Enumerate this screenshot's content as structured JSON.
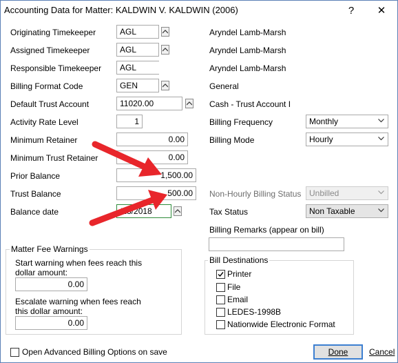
{
  "window": {
    "title": "Accounting Data for Matter: KALDWIN V. KALDWIN (2006)",
    "help_glyph": "?",
    "close_glyph": "✕"
  },
  "left_fields": {
    "originating": {
      "label": "Originating Timekeeper",
      "value": "AGL"
    },
    "assigned": {
      "label": "Assigned Timekeeper",
      "value": "AGL"
    },
    "responsible": {
      "label": "Responsible Timekeeper",
      "value": "AGL"
    },
    "billing_format": {
      "label": "Billing Format Code",
      "value": "GEN"
    },
    "trust_account": {
      "label": "Default Trust Account",
      "value": "11020.00"
    },
    "activity_rate": {
      "label": "Activity Rate Level",
      "value": "1"
    },
    "min_retainer": {
      "label": "Minimum Retainer",
      "value": "0.00"
    },
    "min_trust": {
      "label": "Minimum Trust Retainer",
      "value": "0.00"
    },
    "prior_balance": {
      "label": "Prior Balance",
      "value": "1,500.00"
    },
    "trust_balance": {
      "label": "Trust Balance",
      "value": "500.00"
    },
    "balance_date": {
      "label": "Balance date",
      "value": "/28/2018"
    }
  },
  "right_info": {
    "originating_name": "Aryndel Lamb-Marsh",
    "assigned_name": "Aryndel Lamb-Marsh",
    "responsible_name": "Aryndel Lamb-Marsh",
    "billing_format_name": "General",
    "trust_account_name": "Cash - Trust Account I"
  },
  "right_fields": {
    "billing_frequency": {
      "label": "Billing Frequency",
      "value": "Monthly"
    },
    "billing_mode": {
      "label": "Billing Mode",
      "value": "Hourly"
    },
    "non_hourly_status": {
      "label": "Non-Hourly Billing Status",
      "value": "Unbilled"
    },
    "tax_status": {
      "label": "Tax Status",
      "value": "Non Taxable"
    },
    "billing_remarks": {
      "label": "Billing Remarks (appear on bill)",
      "value": ""
    }
  },
  "fee_warnings": {
    "title": "Matter Fee Warnings",
    "start_label_1": "Start warning when fees reach this",
    "start_label_2": "dollar amount:",
    "start_value": "0.00",
    "escalate_label_1": "Escalate warning when fees reach",
    "escalate_label_2": "this dollar amount:",
    "escalate_value": "0.00"
  },
  "bill_destinations": {
    "title": "Bill Destinations",
    "items": [
      {
        "label": "Printer",
        "checked": true
      },
      {
        "label": "File",
        "checked": false
      },
      {
        "label": "Email",
        "checked": false
      },
      {
        "label": "LEDES-1998B",
        "checked": false
      },
      {
        "label": "Nationwide Electronic Format",
        "checked": false
      }
    ]
  },
  "footer": {
    "advanced_label": "Open Advanced Billing Options on save",
    "done_label": "Done",
    "cancel_label": "Cancel"
  },
  "colors": {
    "annotation_arrow": "#e8262b",
    "focus_border": "#2e8b3a",
    "default_button_border": "#3c7fd1"
  },
  "icons": {
    "spin_button": "up-arrow-icon",
    "dropdown": "chevron-down-icon",
    "annotation": "red-arrow-icon"
  }
}
